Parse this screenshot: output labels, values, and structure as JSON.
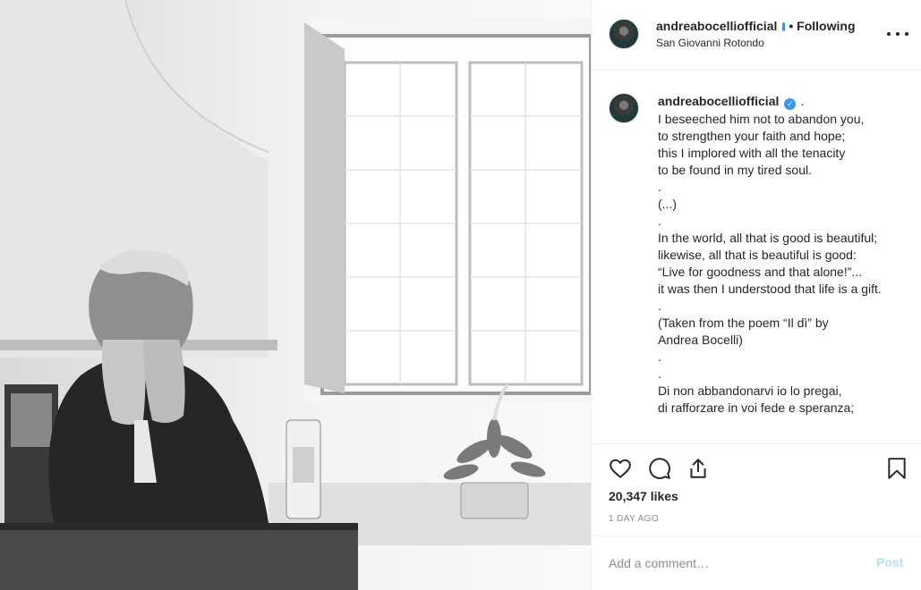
{
  "post": {
    "photo_alt": "photo",
    "header": {
      "username": "andreabocelliofficial",
      "separator": "•",
      "follow_status": "Following",
      "location": "San Giovanni Rotondo"
    },
    "caption": {
      "username": "andreabocelliofficial",
      "verified_glyph": "✓",
      "trailing": ".",
      "text": "I beseeched him not to abandon you,\nto strengthen your faith and hope;\nthis I implored with all the tenacity\nto be found in my tired soul.\n.\n(...)\n.\nIn the world, all that is good is beautiful;\nlikewise, all that is beautiful is good:\n“Live for goodness and that alone!”...\nit was then I understood that life is a gift.\n.\n(Taken from the poem “Il dì” by\nAndrea Bocelli)\n.\n.\nDi non abbandonarvi io lo pregai,\ndi rafforzare in voi fede e speranza;"
    },
    "likes": "20,347 likes",
    "time_ago": "1 DAY AGO",
    "comment": {
      "placeholder": "Add a comment…",
      "post_label": "Post"
    },
    "icons": {
      "like": "heart-icon",
      "comment": "comment-bubble-icon",
      "share": "share-icon",
      "save": "bookmark-icon",
      "more": "more-options-icon"
    },
    "colors": {
      "verified": "#3897f0",
      "post_button_disabled": "#b2dffc",
      "secondary_text": "#8e8e8e"
    }
  }
}
